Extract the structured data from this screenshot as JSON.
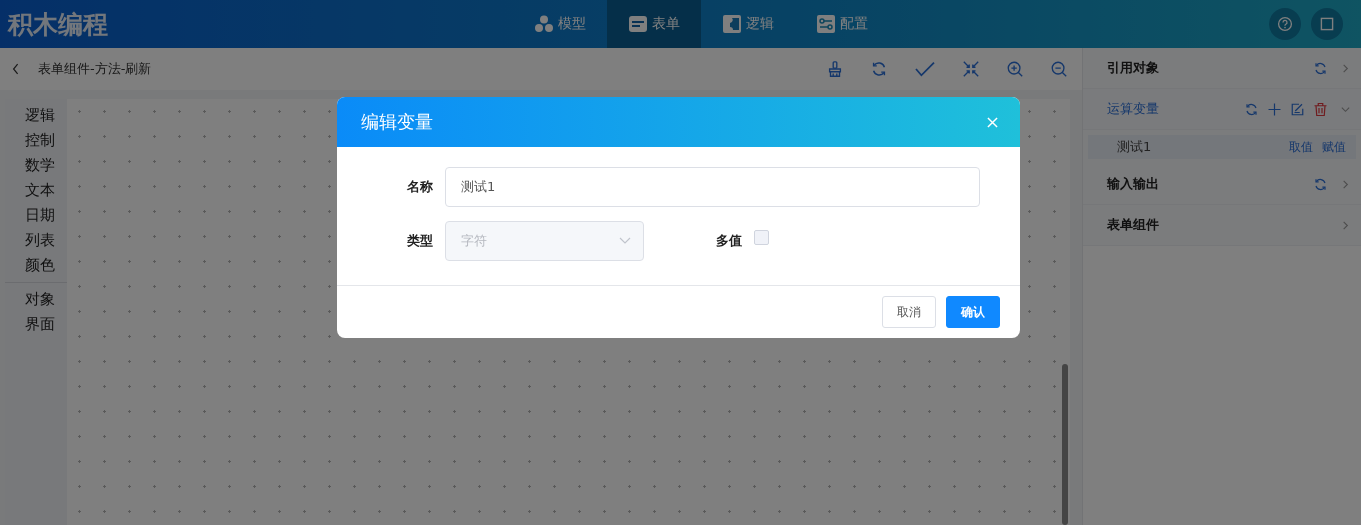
{
  "app": {
    "title": "积木编程"
  },
  "nav_tabs": [
    {
      "label": "模型",
      "kind": "model",
      "selected": false
    },
    {
      "label": "表单",
      "kind": "form",
      "selected": true
    },
    {
      "label": "逻辑",
      "kind": "logic",
      "selected": false
    },
    {
      "label": "配置",
      "kind": "config",
      "selected": false
    }
  ],
  "breadcrumb": "表单组件-方法-刷新",
  "palette": {
    "sections": [
      {
        "items": [
          "逻辑",
          "控制",
          "数学",
          "文本",
          "日期",
          "列表",
          "颜色"
        ]
      },
      {
        "items": [
          "对象",
          "界面"
        ]
      }
    ]
  },
  "panel": {
    "sections": [
      {
        "title": "引用对象",
        "selected": false,
        "expanded": false,
        "refresh": true,
        "tools": false
      },
      {
        "title": "运算变量",
        "selected": true,
        "expanded": true,
        "refresh": true,
        "tools": true,
        "items": [
          {
            "name": "测试1",
            "links": [
              "取值",
              "赋值"
            ]
          }
        ]
      },
      {
        "title": "输入输出",
        "selected": false,
        "expanded": false,
        "refresh": true,
        "tools": false
      },
      {
        "title": "表单组件",
        "selected": false,
        "expanded": false,
        "refresh": false,
        "tools": false
      }
    ]
  },
  "dialog": {
    "title": "编辑变量",
    "fields": [
      {
        "kind": "text",
        "label": "名称",
        "value": "测试1"
      },
      {
        "kind": "select",
        "label": "类型",
        "value": "字符",
        "disabled": true
      },
      {
        "kind": "checkbox",
        "label": "多值",
        "checked": false
      }
    ],
    "buttons": [
      {
        "label": "取消",
        "kind": "default"
      },
      {
        "label": "确认",
        "kind": "primary"
      }
    ]
  }
}
